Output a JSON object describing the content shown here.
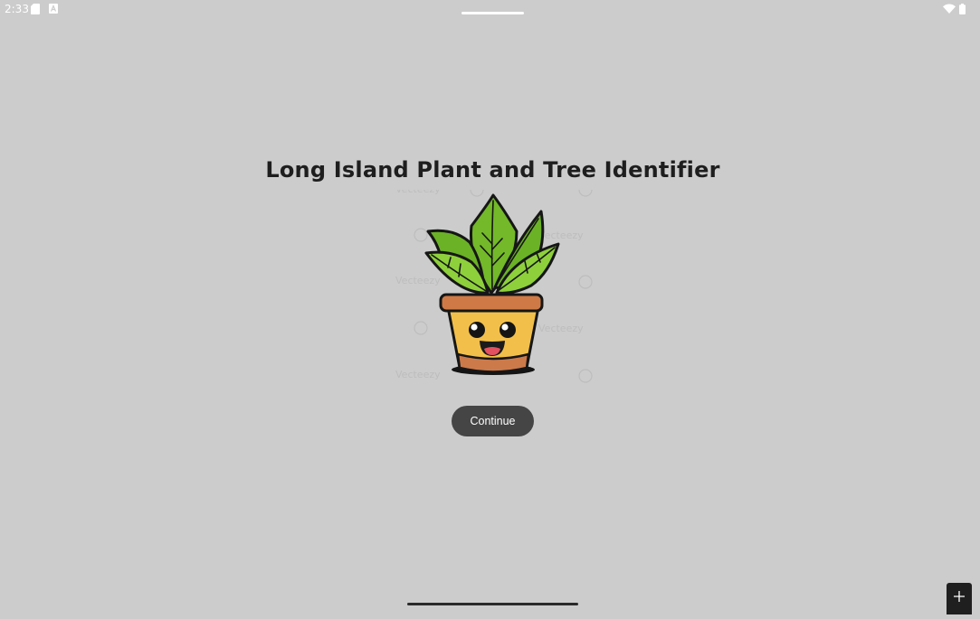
{
  "status_bar": {
    "time": "2:33",
    "left_icons": [
      "sd-card-icon",
      "text-notification-icon"
    ],
    "right_icons": [
      "wifi-icon",
      "battery-icon"
    ]
  },
  "main": {
    "title": "Long Island Plant and Tree Identifier",
    "illustration": "potted-plant-mascot",
    "watermark": "Vecteezy",
    "continue_label": "Continue"
  },
  "navigation": {
    "corner_icon": "plus-icon"
  },
  "colors": {
    "background": "#cccccc",
    "button": "#454545",
    "title": "#1e1e1e"
  }
}
